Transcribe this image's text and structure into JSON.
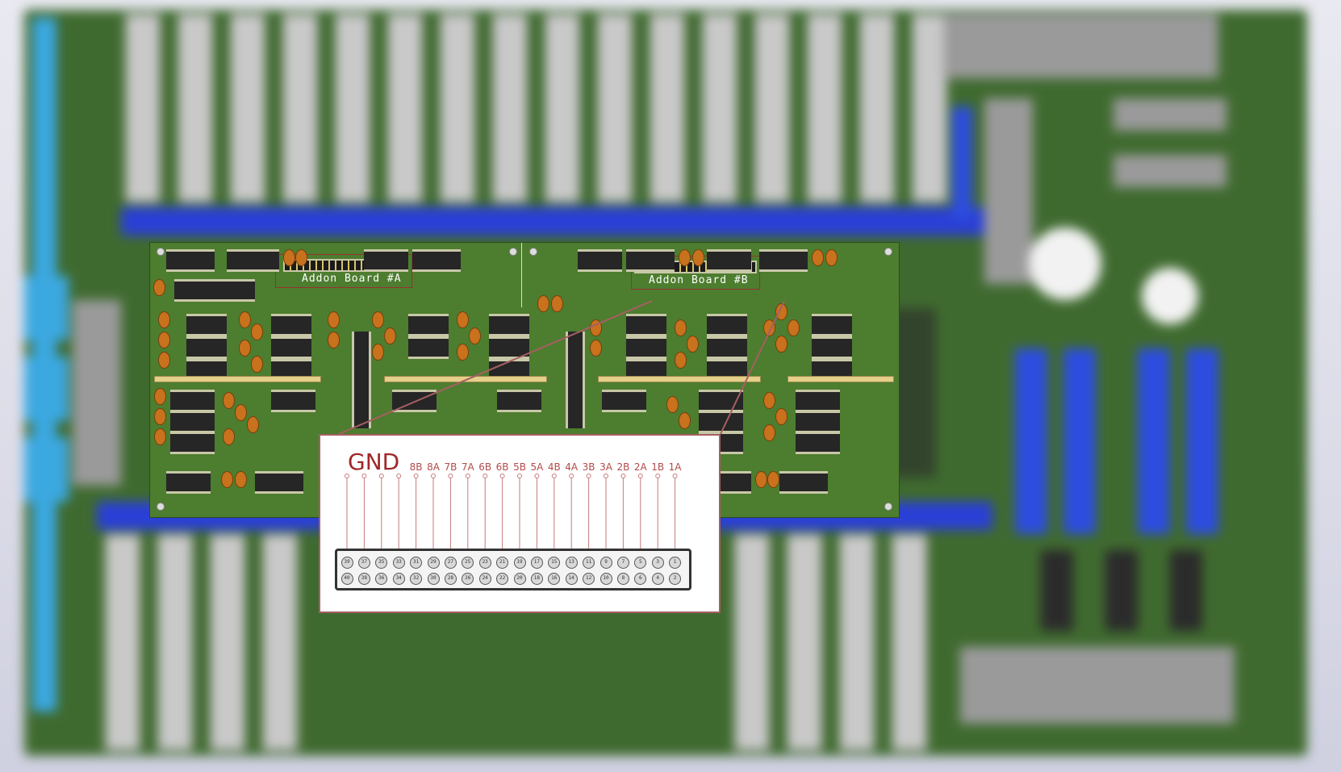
{
  "board": {
    "addon_a_label": "Addon Board #A",
    "addon_b_label": "Addon Board #B"
  },
  "callout": {
    "gnd_label": "GND",
    "pin_labels": [
      "8B",
      "8A",
      "7B",
      "7A",
      "6B",
      "6B",
      "5B",
      "5A",
      "4B",
      "4A",
      "3B",
      "3A",
      "2B",
      "2A",
      "1B",
      "1A"
    ],
    "top_row_pins": [
      "39",
      "37",
      "35",
      "33",
      "31",
      "29",
      "27",
      "25",
      "23",
      "21",
      "19",
      "17",
      "15",
      "13",
      "11",
      "9",
      "7",
      "5",
      "3",
      "1"
    ],
    "bottom_row_pins": [
      "40",
      "38",
      "36",
      "34",
      "32",
      "30",
      "28",
      "26",
      "24",
      "22",
      "20",
      "18",
      "16",
      "14",
      "12",
      "10",
      "8",
      "6",
      "4",
      "2"
    ]
  },
  "colors": {
    "pcb_green": "#4d7d2f",
    "callout_border": "#a65f62",
    "gnd_text": "#a02828",
    "pin_label_text": "#b24a4a",
    "rail_blue": "#2a3fd6"
  }
}
